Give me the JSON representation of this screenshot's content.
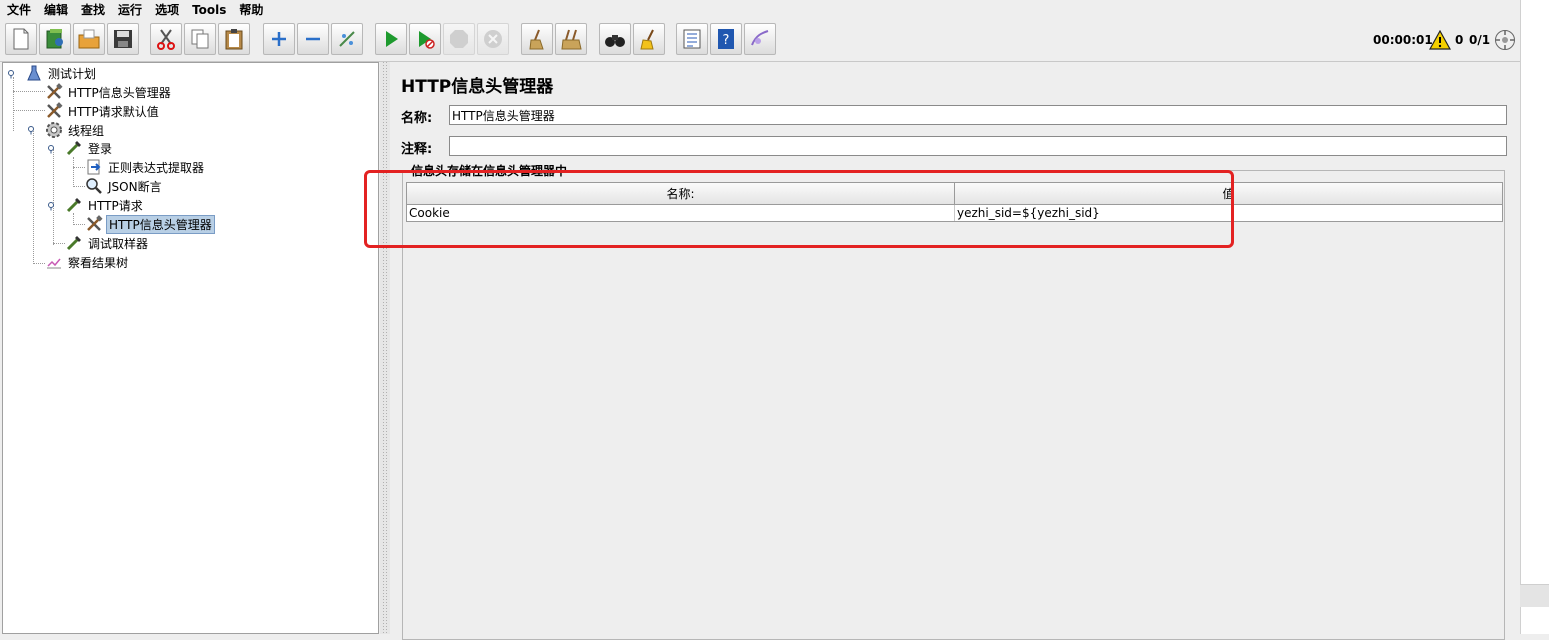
{
  "menu": [
    "文件",
    "编辑",
    "查找",
    "运行",
    "选项",
    "Tools",
    "帮助"
  ],
  "toolbar": {
    "buttons": [
      {
        "name": "new-button",
        "icon": "new-document-icon"
      },
      {
        "name": "templates-button",
        "icon": "templates-icon"
      },
      {
        "name": "open-button",
        "icon": "open-folder-icon"
      },
      {
        "name": "save-button",
        "icon": "save-disk-icon"
      },
      {
        "name": "cut-button",
        "icon": "scissors-icon"
      },
      {
        "name": "copy-button",
        "icon": "copy-icon"
      },
      {
        "name": "paste-button",
        "icon": "paste-clipboard-icon"
      },
      {
        "name": "expand-button",
        "icon": "plus-icon"
      },
      {
        "name": "collapse-button",
        "icon": "minus-icon"
      },
      {
        "name": "toggle-button",
        "icon": "toggle-wand-icon"
      },
      {
        "name": "start-button",
        "icon": "play-icon"
      },
      {
        "name": "start-no-pauses-button",
        "icon": "play-no-timer-icon"
      },
      {
        "name": "stop-button",
        "icon": "stop-icon"
      },
      {
        "name": "shutdown-button",
        "icon": "shutdown-icon"
      },
      {
        "name": "clear-button",
        "icon": "broom-clear-icon"
      },
      {
        "name": "clear-all-button",
        "icon": "broom-clear-all-icon"
      },
      {
        "name": "search-button",
        "icon": "binoculars-icon"
      },
      {
        "name": "reset-search-button",
        "icon": "reset-broom-icon"
      },
      {
        "name": "function-helper-button",
        "icon": "function-list-icon"
      },
      {
        "name": "help-button",
        "icon": "help-book-icon"
      },
      {
        "name": "remote-button",
        "icon": "remote-icon"
      }
    ],
    "status": {
      "elapsed": "00:00:01",
      "errors": "0",
      "threads": "0/1"
    }
  },
  "tree": {
    "nodes": [
      {
        "label": "测试计划",
        "icon": "test-plan-flask-icon"
      },
      {
        "label": "HTTP信息头管理器",
        "icon": "wrench-hammer-icon"
      },
      {
        "label": "HTTP请求默认值",
        "icon": "wrench-hammer-icon"
      },
      {
        "label": "线程组",
        "icon": "gear-icon"
      },
      {
        "label": "登录",
        "icon": "pipette-sampler-icon"
      },
      {
        "label": "正则表达式提取器",
        "icon": "extractor-arrow-icon"
      },
      {
        "label": "JSON断言",
        "icon": "magnifier-icon"
      },
      {
        "label": "HTTP请求",
        "icon": "pipette-sampler-icon"
      },
      {
        "label": "HTTP信息头管理器",
        "icon": "wrench-hammer-icon"
      },
      {
        "label": "调试取样器",
        "icon": "pipette-sampler-icon"
      },
      {
        "label": "察看结果树",
        "icon": "chart-listener-icon"
      }
    ]
  },
  "panel": {
    "title": "HTTP信息头管理器",
    "name_label": "名称:",
    "name_value": "HTTP信息头管理器",
    "comment_label": "注释:",
    "comment_value": "",
    "group_title": "信息头存储在信息头管理器中",
    "table": {
      "headers": [
        "名称:",
        "值"
      ],
      "rows": [
        [
          "Cookie",
          "yezhi_sid=${yezhi_sid}"
        ]
      ]
    }
  },
  "colors": {
    "highlight": "#e32222",
    "selection": "#b8cfe5"
  }
}
